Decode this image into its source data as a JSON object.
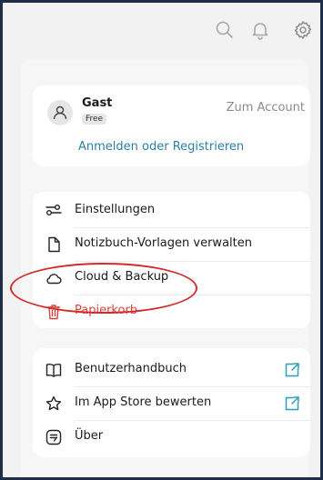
{
  "toolbar": {
    "search_icon": "search-icon",
    "bell_icon": "bell-icon",
    "gear_icon": "gear-icon"
  },
  "account": {
    "name": "Gast",
    "plan_badge": "Free",
    "account_link": "Zum Account",
    "login_link": "Anmelden oder Registrieren"
  },
  "menu_main": [
    {
      "label": "Einstellungen",
      "icon": "settings-sliders-icon"
    },
    {
      "label": "Notizbuch-Vorlagen verwalten",
      "icon": "document-icon"
    },
    {
      "label": "Cloud & Backup",
      "icon": "cloud-icon"
    },
    {
      "label": "Papierkorb",
      "icon": "trash-icon"
    }
  ],
  "menu_help": [
    {
      "label": "Benutzerhandbuch",
      "icon": "book-icon"
    },
    {
      "label": "Im App Store bewerten",
      "icon": "star-icon"
    },
    {
      "label": "Über",
      "icon": "info-note-icon"
    }
  ],
  "colors": {
    "accent": "#2a7fa8",
    "danger": "#d9423c",
    "annotation": "#d32b2b",
    "frame_border": "#1f2d4a"
  }
}
